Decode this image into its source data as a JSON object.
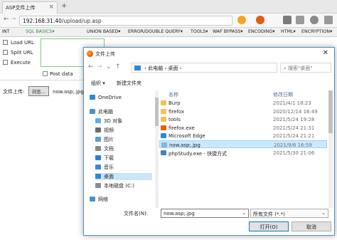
{
  "browser": {
    "tab_title": "ASP文件上传",
    "tab_close": "×",
    "new_tab": "+",
    "url_host": "192.168.31.40",
    "url_path": "/upload/up.asp",
    "back": "←",
    "forward": "→"
  },
  "hackbar": {
    "int_label": "INT",
    "items": [
      "SQL BASICS▾",
      "UNION BASED▾",
      "ERROR/DOUBLE QUERY▾",
      "TOOLS▾",
      "WAF BYPASS▾",
      "ENCODING▾",
      "HTML▾",
      "ENCRYPTION▾"
    ],
    "side": [
      {
        "label": "Load URL"
      },
      {
        "label": "Split URL"
      },
      {
        "label": "Execute"
      }
    ],
    "post_data_label": "Post data"
  },
  "page": {
    "upload_label": "文件上传:",
    "browse_label": "浏览...",
    "file_value": "now.asp;.jpg"
  },
  "dialog": {
    "title": "文件上传",
    "close": "✕",
    "path_parts": [
      "此电脑",
      "桌面"
    ],
    "search_placeholder": "搜索\"桌面\"",
    "organize": "组织 ▾",
    "new_folder": "新建文件夹",
    "col_name": "名称",
    "col_date": "修改日期",
    "nav": [
      {
        "label": "OneDrive",
        "color": "#2b89d6"
      },
      {
        "label": "此电脑",
        "color": "#4a90c8"
      },
      {
        "label": "3D 对象",
        "color": "#5ab0e8"
      },
      {
        "label": "视频",
        "color": "#6a6a6a"
      },
      {
        "label": "图片",
        "color": "#5aa0d0"
      },
      {
        "label": "文档",
        "color": "#8a8a8a"
      },
      {
        "label": "下载",
        "color": "#2d7fd2"
      },
      {
        "label": "音乐",
        "color": "#3a8ad8"
      },
      {
        "label": "桌面",
        "color": "#2b89d6"
      },
      {
        "label": "本地磁盘 (C:)",
        "color": "#8a8a8a"
      },
      {
        "label": "网络",
        "color": "#4a90c8"
      }
    ],
    "files": [
      {
        "name": "Burp",
        "date": "2021/4/1 18:23",
        "icon": "folder-icon",
        "color": "#f2c14e"
      },
      {
        "name": "firefox",
        "date": "2020/12/14 16:49",
        "icon": "folder-icon",
        "color": "#f2c14e"
      },
      {
        "name": "tools",
        "date": "2021/5/24 19:28",
        "icon": "folder-icon",
        "color": "#f2c14e"
      },
      {
        "name": "firefox.exe",
        "date": "2021/5/24 21:31",
        "icon": "firefox-icon",
        "color": "#e66000"
      },
      {
        "name": "Microsoft Edge",
        "date": "2021/5/24 21:21",
        "icon": "edge-icon",
        "color": "#1f8cd6"
      },
      {
        "name": "now.asp;.jpg",
        "date": "2021/9/6 16:59",
        "icon": "image-file-icon",
        "color": "#7db7e8"
      },
      {
        "name": "phpStudy.exe - 快捷方式",
        "date": "2021/5/30 21:06",
        "icon": "phpstudy-icon",
        "color": "#4a7fc0"
      }
    ],
    "filename_label": "文件名(N):",
    "filename_value": "now.asp;.jpg",
    "filetype_value": "所有文件 (*.*)",
    "open_label": "打开(O)",
    "cancel_label": "取消"
  }
}
